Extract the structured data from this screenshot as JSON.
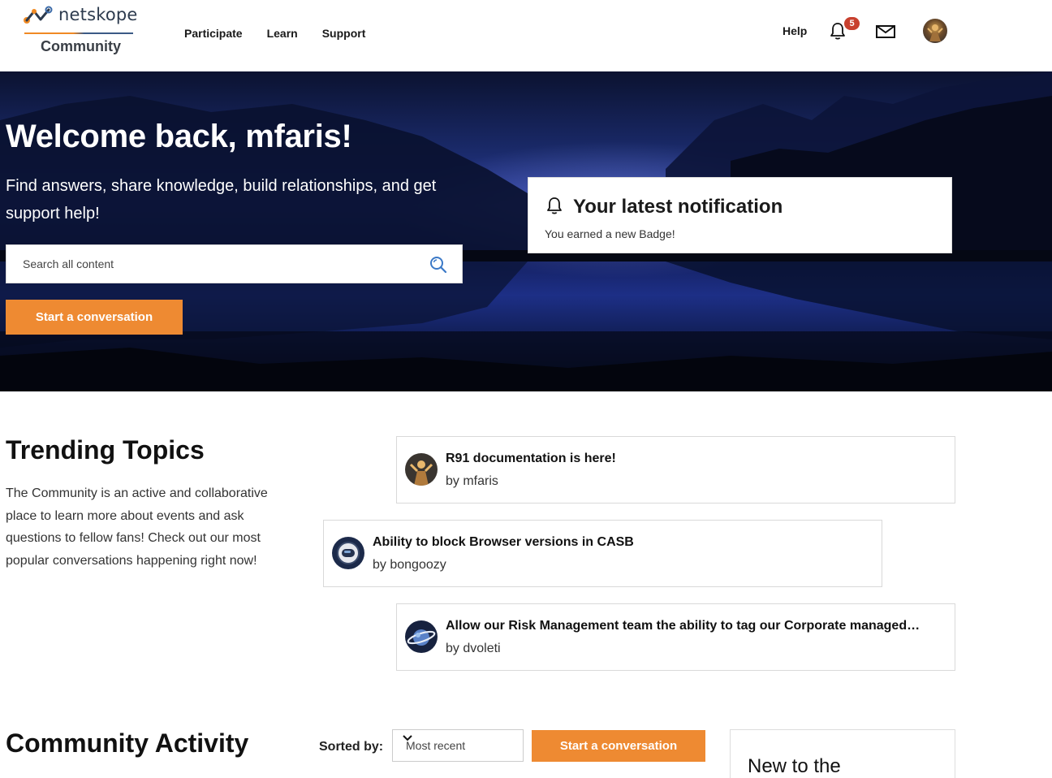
{
  "brand": {
    "name": "netskope",
    "subtitle": "Community"
  },
  "nav": {
    "items": [
      "Participate",
      "Learn",
      "Support"
    ],
    "help": "Help",
    "notification_count": "5"
  },
  "hero": {
    "title": "Welcome back, mfaris!",
    "subtitle": "Find answers, share knowledge, build relationships, and get support help!",
    "search_placeholder": "Search all content",
    "cta": "Start a conversation"
  },
  "notification": {
    "title": "Your latest notification",
    "text": "You earned a new Badge!"
  },
  "trending": {
    "title": "Trending Topics",
    "description": "The Community is an active and collaborative place to learn more about events and ask questions to fellow fans! Check out our most popular conversations happening right now!",
    "topics": [
      {
        "title": "R91 documentation is here!",
        "author": "by mfaris",
        "avatar_icon": "person-photo-icon"
      },
      {
        "title": "Ability to block Browser versions in CASB",
        "author": "by bongoozy",
        "avatar_icon": "astronaut-helmet-icon"
      },
      {
        "title": "Allow our Risk Management team the ability to tag our Corporate managed devices",
        "author": "by dvoleti",
        "avatar_icon": "planet-icon"
      }
    ]
  },
  "activity": {
    "title": "Community Activity",
    "sorted_label": "Sorted by:",
    "sort_value": "Most recent",
    "cta": "Start a conversation",
    "side_card_title": "New to the"
  },
  "colors": {
    "accent": "#ee8a32",
    "badge": "#c8402e",
    "hero_blue": "#1d2f86"
  }
}
